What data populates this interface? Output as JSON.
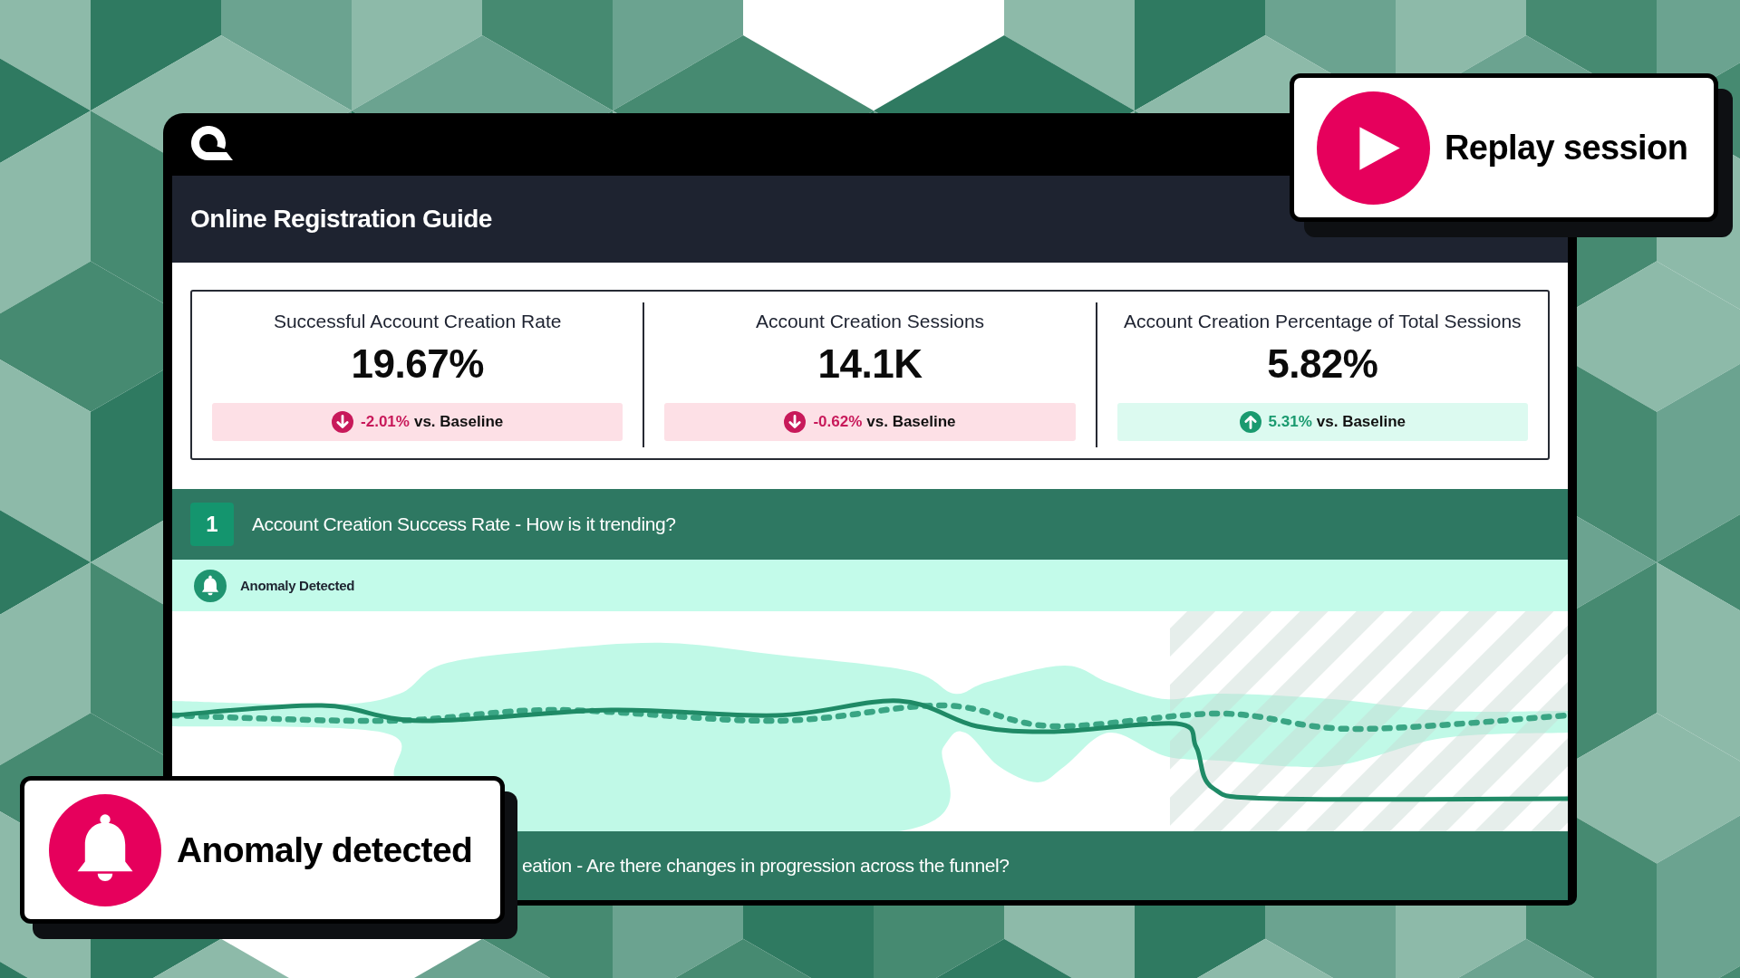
{
  "app": {
    "title": "Online Registration Guide"
  },
  "metrics": [
    {
      "label": "Successful Account Creation Rate",
      "value": "19.67%",
      "change": "-2.01%",
      "comparison": "vs. Baseline",
      "kind": "down"
    },
    {
      "label": "Account Creation Sessions",
      "value": "14.1K",
      "change": "-0.62%",
      "comparison": "vs. Baseline",
      "kind": "down"
    },
    {
      "label": "Account Creation Percentage of Total Sessions",
      "value": "5.82%",
      "change": "5.31%",
      "comparison": "vs. Baseline",
      "kind": "up"
    }
  ],
  "sections": [
    {
      "kind": "chart",
      "number": "1",
      "title": "Account Creation Success Rate - How is it trending?",
      "alert": "Anomaly Detected"
    },
    {
      "kind": "heading",
      "title": "eation - Are there changes in progression across the funnel?"
    }
  ],
  "replay_button": {
    "label": "Replay session"
  },
  "notification": {
    "title": "Anomaly detected"
  }
}
